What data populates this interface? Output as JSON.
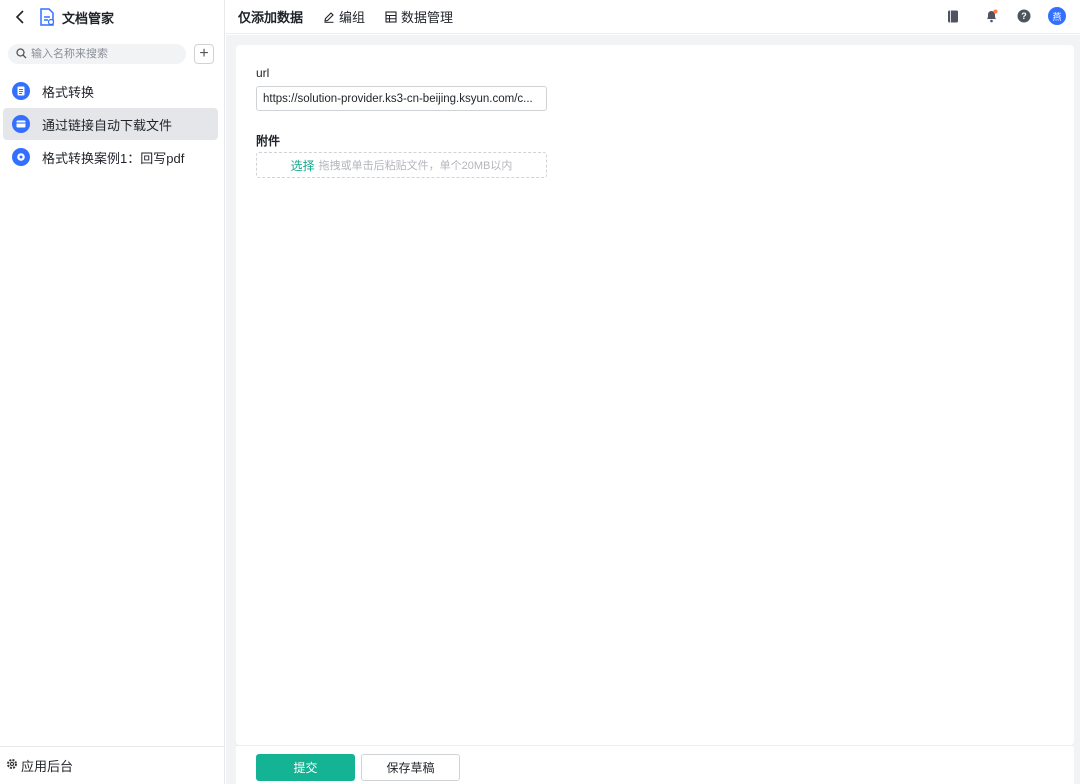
{
  "sidebar": {
    "app_title": "文档管家",
    "search_placeholder": "输入名称来搜索",
    "add_label": "+",
    "items": [
      {
        "label": "格式转换",
        "active": false
      },
      {
        "label": "通过链接自动下载文件",
        "active": true
      },
      {
        "label": "格式转换案例1：回写pdf",
        "active": false
      }
    ],
    "footer_label": "应用后台"
  },
  "topbar": {
    "tabs": [
      {
        "label": "仅添加数据"
      },
      {
        "label": "编组"
      },
      {
        "label": "数据管理"
      }
    ],
    "icons": [
      "book-icon",
      "bell-icon",
      "help-icon"
    ],
    "avatar_text": "燕",
    "avatar_color": "#3370ff"
  },
  "form": {
    "url_label": "url",
    "url_value": "https://solution-provider.ks3-cn-beijing.ksyun.com/c...",
    "attachment_label": "附件",
    "upload_link": "选择",
    "upload_hint": "拖拽或单击后粘贴文件，单个20MB以内"
  },
  "actions": {
    "submit_label": "提交",
    "draft_label": "保存草稿"
  },
  "colors": {
    "accent": "#14b393",
    "link": "#14a88c",
    "nav_icon": "#3370ff"
  }
}
